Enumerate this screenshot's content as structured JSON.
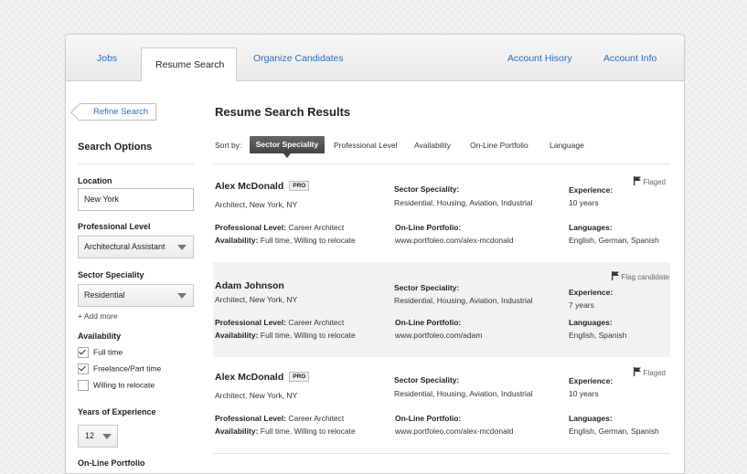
{
  "tabs": {
    "jobs": "Jobs",
    "resume_search": "Resume Search",
    "organize": "Organize Candidates",
    "history": "Account Hisory",
    "info": "Account Info"
  },
  "sidebar": {
    "refine": "Refine Search",
    "title": "Search Options",
    "location_label": "Location",
    "location_value": "New York",
    "level_label": "Professional Level",
    "level_value": "Architectural Assistant",
    "sector_label": "Sector Speciality",
    "sector_value": "Residential",
    "add_more": "+ Add more",
    "availability_label": "Availability",
    "availability_options": [
      {
        "label": "Full time",
        "checked": true
      },
      {
        "label": "Freelance/Part time",
        "checked": true
      },
      {
        "label": "Willing to relocate",
        "checked": false
      }
    ],
    "years_label": "Years of Experience",
    "years_value": "12",
    "portfolio_label": "On-Line Portfolio"
  },
  "main": {
    "title": "Resume Search Results",
    "sort_label": "Sort by:",
    "sort_options": [
      "Sector Speciality",
      "Professional Level",
      "Availability",
      "On-Line Portfolio",
      "Language"
    ],
    "field_labels": {
      "sector": "Sector Speciality:",
      "experience": "Experience:",
      "level": "Professional Level:",
      "availability": "Availability:",
      "portfolio": "On-Line Portfolio:",
      "languages": "Languages:"
    },
    "results": [
      {
        "name": "Alex McDonald",
        "pro": "PRO",
        "location": "Architect, New York, NY",
        "sector": "Residential, Housing, Aviation, Industrial",
        "experience": "10 years",
        "level": "Career Architect",
        "availability": "Full time, Willing to relocate",
        "portfolio": "www.portfoleo.com/alex-mcdonald",
        "languages": "English, German, Spanish",
        "flag": "Flaged"
      },
      {
        "name": "Adam Johnson",
        "pro": "",
        "location": "Architect, New York, NY",
        "sector": "Residential, Housing, Aviation, Industrial",
        "experience": "7 years",
        "level": "Career Architect",
        "availability": "Full time, Willing to relocate",
        "portfolio": "www.portfoleo.com/adam",
        "languages": "English, Spanish",
        "flag": "Flag candidate"
      },
      {
        "name": "Alex McDonald",
        "pro": "PRO",
        "location": "Architect, New York, NY",
        "sector": "Residential, Housing, Aviation, Industrial",
        "experience": "10 years",
        "level": "Career Architect",
        "availability": "Full time, Willing to relocate",
        "portfolio": "www.portfoleo.com/alex-mcdonald",
        "languages": "English, German, Spanish",
        "flag": "Flaged"
      }
    ]
  }
}
